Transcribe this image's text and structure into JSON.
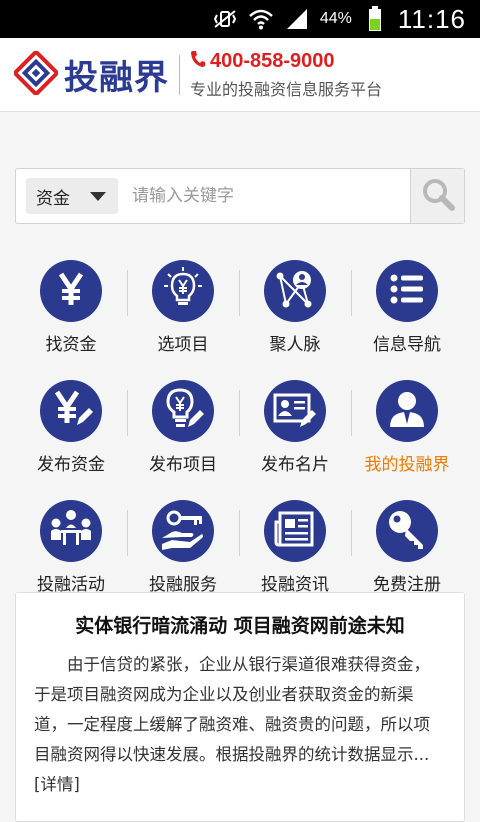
{
  "status_bar": {
    "battery": "44%",
    "time": "11:16"
  },
  "header": {
    "logo_text": "投融界",
    "phone": "400-858-9000",
    "slogan": "专业的投融资信息服务平台"
  },
  "search": {
    "category": "资金",
    "placeholder": "请输入关键字"
  },
  "grid": [
    {
      "label": "找资金",
      "icon": "yen-icon"
    },
    {
      "label": "选项目",
      "icon": "lightbulb-yen-icon"
    },
    {
      "label": "聚人脉",
      "icon": "network-icon"
    },
    {
      "label": "信息导航",
      "icon": "list-icon"
    },
    {
      "label": "发布资金",
      "icon": "yen-pencil-icon"
    },
    {
      "label": "发布项目",
      "icon": "lightbulb-pencil-icon"
    },
    {
      "label": "发布名片",
      "icon": "card-pencil-icon"
    },
    {
      "label": "我的投融界",
      "icon": "user-icon",
      "highlight": true
    },
    {
      "label": "投融活动",
      "icon": "meeting-icon"
    },
    {
      "label": "投融服务",
      "icon": "key-hand-icon"
    },
    {
      "label": "投融资讯",
      "icon": "newspaper-icon"
    },
    {
      "label": "免费注册",
      "icon": "key-icon"
    }
  ],
  "article": {
    "title": "实体银行暗流涌动 项目融资网前途未知",
    "body": "由于信贷的紧张，企业从银行渠道很难获得资金，于是项目融资网成为企业以及创业者获取资金的新渠道，一定程度上缓解了融资难、融资贵的问题，所以项目融资网得以快速发展。根据投融界的统计数据显示...",
    "more": "[详情]"
  },
  "colors": {
    "brand_blue": "#2b3a8e",
    "phone_red": "#e02020",
    "highlight_orange": "#f07a00"
  }
}
